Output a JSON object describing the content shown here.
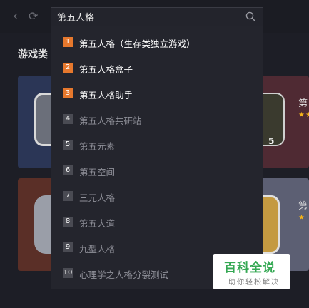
{
  "search": {
    "value": "第五人格"
  },
  "nav": {
    "back_icon": "chevron-left-icon",
    "refresh_icon": "refresh-icon"
  },
  "page": {
    "section_title": "游戏类",
    "right_label_1": "第",
    "right_label_2": "第",
    "icon_badge": "5",
    "stars_1": "★★",
    "stars_2": "★"
  },
  "suggestions": [
    {
      "rank": "1",
      "text": "第五人格（生存类独立游戏）",
      "hot": true
    },
    {
      "rank": "2",
      "text": "第五人格盒子",
      "hot": true
    },
    {
      "rank": "3",
      "text": "第五人格助手",
      "hot": true
    },
    {
      "rank": "4",
      "text": "第五人格共研站",
      "hot": false
    },
    {
      "rank": "5",
      "text": "第五元素",
      "hot": false
    },
    {
      "rank": "6",
      "text": "第五空间",
      "hot": false
    },
    {
      "rank": "7",
      "text": "三元人格",
      "hot": false
    },
    {
      "rank": "8",
      "text": "第五大道",
      "hot": false
    },
    {
      "rank": "9",
      "text": "九型人格",
      "hot": false
    },
    {
      "rank": "10",
      "text": "心理学之人格分裂测试",
      "hot": false
    }
  ],
  "watermark": {
    "title": "百科全说",
    "subtitle": "助你轻松解决"
  },
  "colors": {
    "hot_rank": "#e6782d",
    "normal_rank": "#4a4b53",
    "background": "#1d1e26"
  }
}
